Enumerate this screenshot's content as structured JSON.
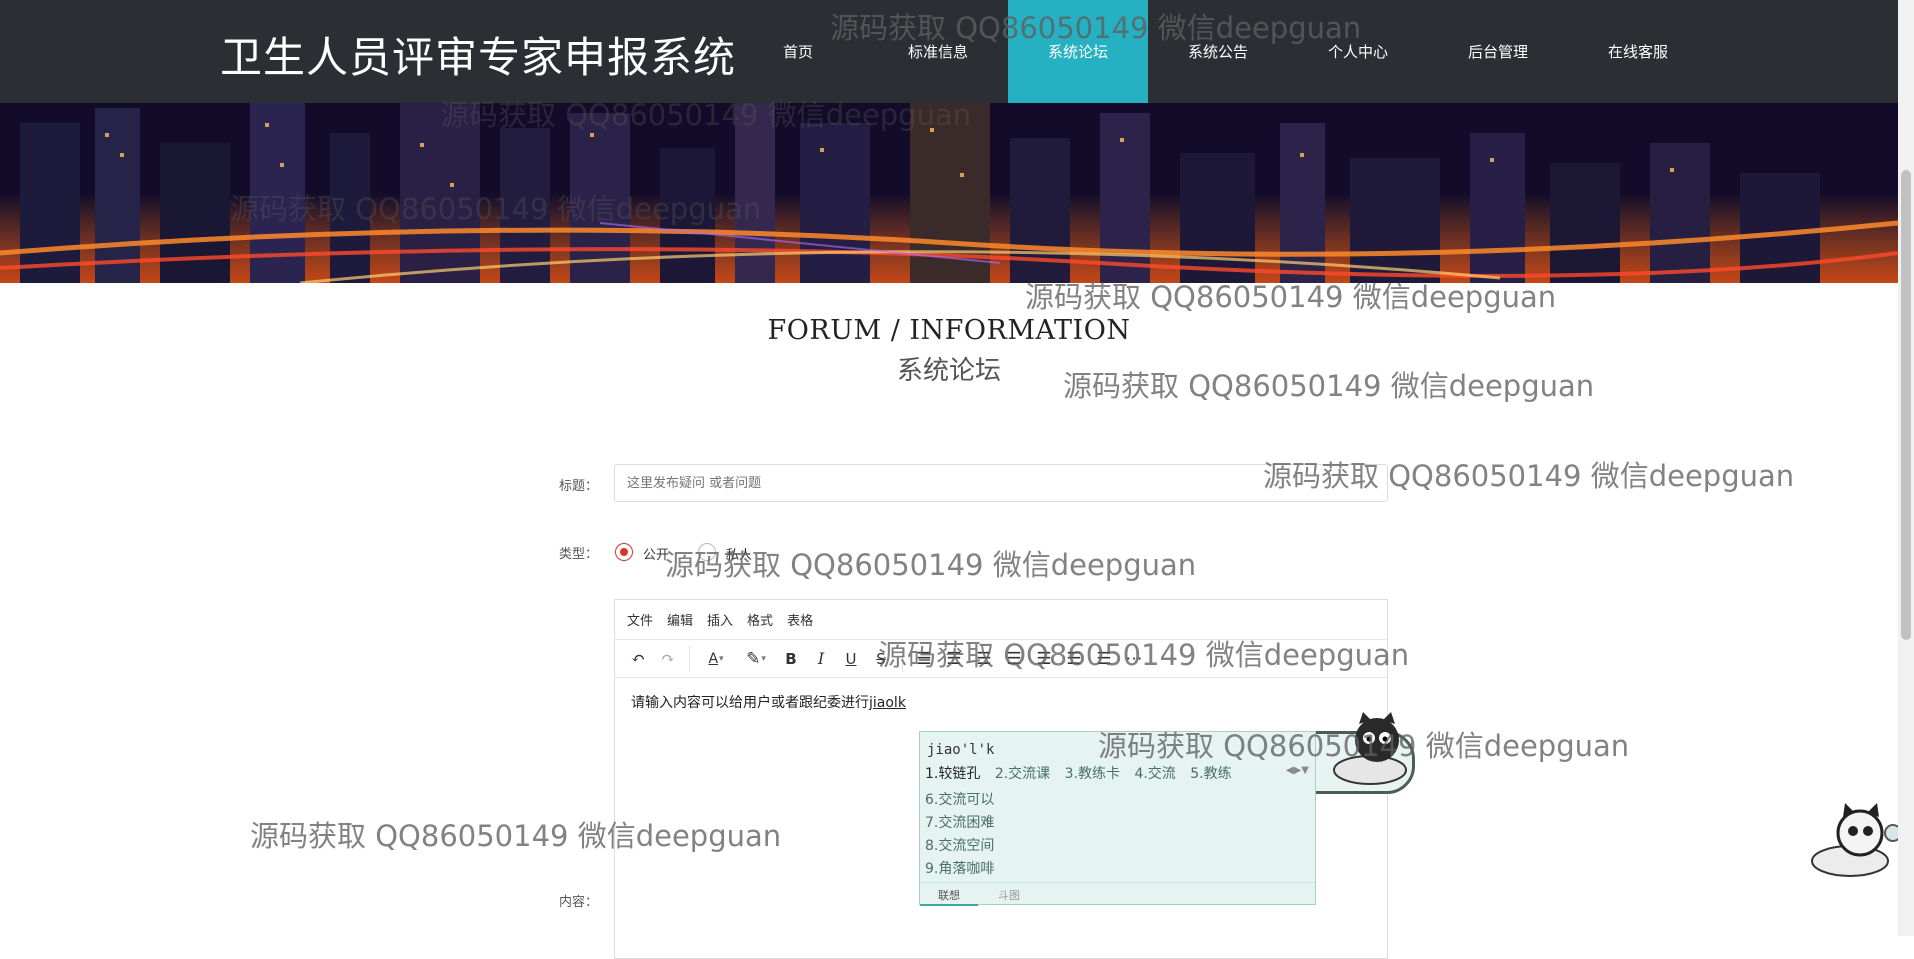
{
  "header": {
    "site_title": "卫生人员评审专家申报系统",
    "nav": [
      {
        "label": "首页",
        "active": false
      },
      {
        "label": "标准信息",
        "active": false
      },
      {
        "label": "系统论坛",
        "active": true
      },
      {
        "label": "系统公告",
        "active": false
      },
      {
        "label": "个人中心",
        "active": false
      },
      {
        "label": "后台管理",
        "active": false
      },
      {
        "label": "在线客服",
        "active": false
      }
    ],
    "accent_color": "#25b1c2"
  },
  "section": {
    "title_en": "FORUM / INFORMATION",
    "title_cn": "系统论坛"
  },
  "form": {
    "title_label": "标题：",
    "title_placeholder": "这里发布疑问 或者问题",
    "type_label": "类型：",
    "type_options": [
      {
        "label": "公开",
        "checked": true
      },
      {
        "label": "私人",
        "checked": false
      }
    ],
    "content_label": "内容："
  },
  "editor": {
    "menu": [
      "文件",
      "编辑",
      "插入",
      "格式",
      "表格"
    ],
    "toolbar_icons": [
      "undo-icon",
      "redo-icon",
      "text-color-icon",
      "highlight-icon",
      "bold-icon",
      "italic-icon",
      "underline-icon",
      "strikethrough-icon",
      "align-left-icon",
      "align-center-icon",
      "align-right-icon",
      "align-justify-icon",
      "bullet-list-icon",
      "numbered-list-icon",
      "indent-icon",
      "more-icon"
    ],
    "content_text": "请输入内容可以给用户或者跟纪委进行",
    "typed_text": "jiaolk"
  },
  "ime": {
    "composition": "jiao'l'k",
    "row_candidates": [
      "1.较链孔",
      "2.交流课",
      "3.教练卡",
      "4.交流",
      "5.教练"
    ],
    "column_candidates": [
      "6.交流可以",
      "7.交流困难",
      "8.交流空间",
      "9.角落咖啡"
    ],
    "tabs": [
      "联想",
      "斗图"
    ]
  },
  "watermark_text": "源码获取 QQ86050149 微信deepguan"
}
